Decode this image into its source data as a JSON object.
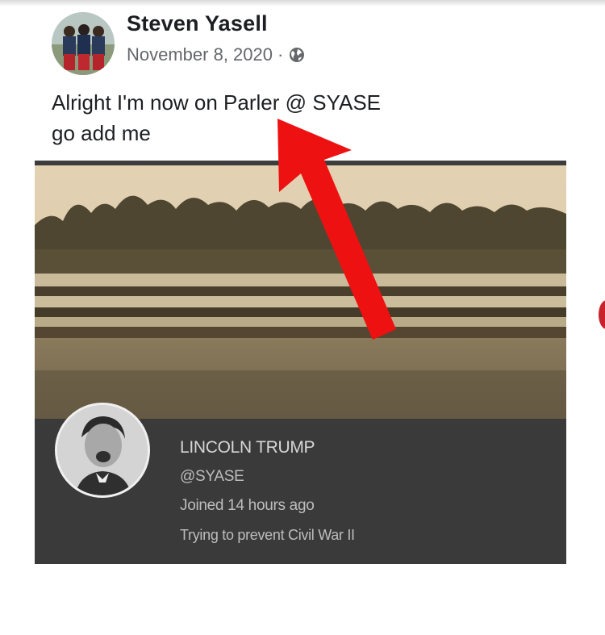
{
  "post": {
    "author": "Steven Yasell",
    "date": "November 8, 2020",
    "separator": "·",
    "privacy_icon": "globe-icon",
    "text_lines": [
      "Alright I'm now on Parler @ SYASE",
      "go add me"
    ]
  },
  "parler_profile": {
    "name": "LINCOLN TRUMP",
    "handle": "@SYASE",
    "joined": "Joined 14 hours ago",
    "bio": "Trying to prevent Civil War II"
  },
  "annotation": {
    "arrow_color": "#ee1111",
    "icon": "red-arrow-icon"
  },
  "colors": {
    "name_text": "#1c1e21",
    "meta_text": "#65676b",
    "profile_band": "#3a3a3a"
  }
}
